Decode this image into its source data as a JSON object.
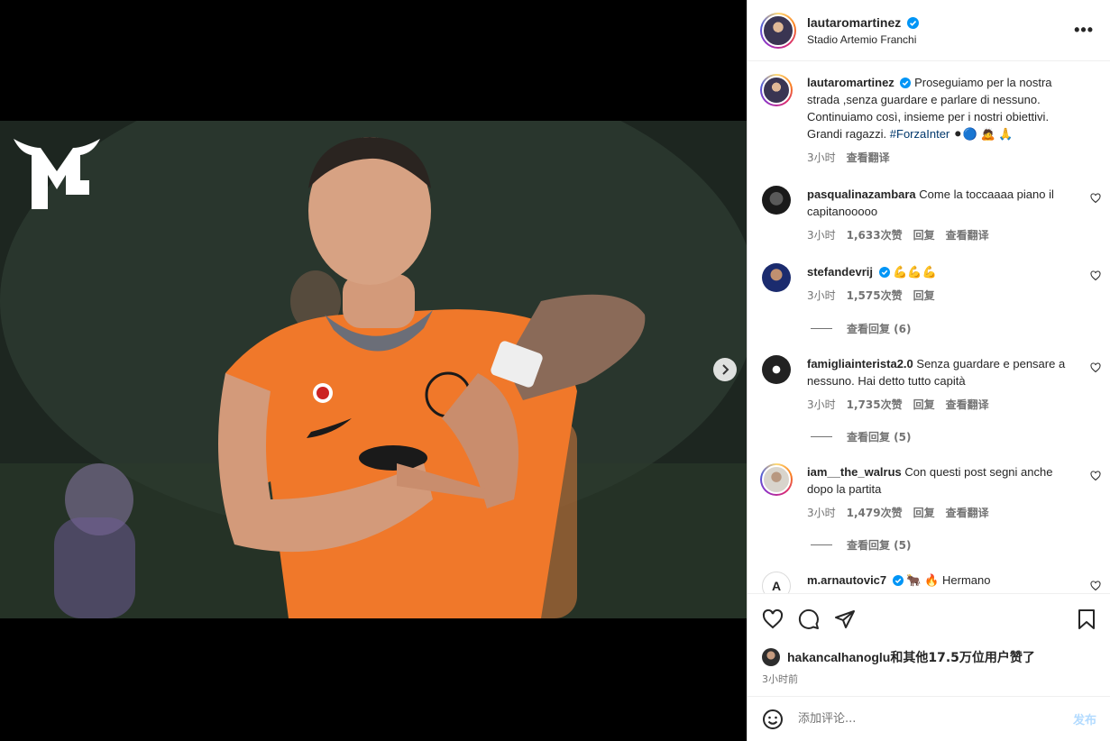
{
  "post": {
    "username": "lautaromartinez",
    "location": "Stadio Artemio Franchi",
    "more_label": "•••",
    "caption": {
      "username": "lautaromartinez",
      "text": "Proseguiamo per la nostra strada ,senza guardare e parlare di nessuno. Continuiamo così, insieme per i nostri obiettivi. Grandi ragazzi.",
      "hashtag": "#ForzaInter",
      "emojis": "⚫🔵 🙇 🙏",
      "time": "3小时",
      "translate": "查看翻译"
    }
  },
  "media": {
    "logo": "ML",
    "slide_count": 4,
    "active_slide": 1
  },
  "comments": [
    {
      "username": "pasqualinazambara",
      "verified": false,
      "text": "Come la toccaaaa piano il capitanooooo",
      "time": "3小时",
      "likes": "1,633次赞",
      "reply": "回复",
      "translate": "查看翻译",
      "replies": ""
    },
    {
      "username": "stefandevrij",
      "verified": true,
      "text": "💪💪💪",
      "time": "3小时",
      "likes": "1,575次赞",
      "reply": "回复",
      "translate": "",
      "replies": "查看回复 (6)"
    },
    {
      "username": "famigliainterista2.0",
      "verified": false,
      "text": "Senza guardare e pensare a nessuno. Hai detto tutto capità",
      "time": "3小时",
      "likes": "1,735次赞",
      "reply": "回复",
      "translate": "查看翻译",
      "replies": "查看回复 (5)"
    },
    {
      "username": "iam__the_walrus",
      "verified": false,
      "text": "Con questi post segni anche dopo la partita",
      "time": "3小时",
      "likes": "1,479次赞",
      "reply": "回复",
      "translate": "查看翻译",
      "replies": "查看回复 (5)"
    },
    {
      "username": "m.arnautovic7",
      "verified": true,
      "text": "🐂 🔥 Hermano",
      "time": "",
      "likes": "",
      "reply": "",
      "translate": "",
      "replies": ""
    }
  ],
  "likes": {
    "liker": "hakancalhanoglu",
    "text": "和其他17.5万位用户赞了"
  },
  "timeago": "3小时前",
  "composer": {
    "placeholder": "添加评论...",
    "post_label": "发布"
  },
  "colors": {
    "jersey": "#f0782a",
    "verified": "#0095f6",
    "link": "#00376b"
  }
}
